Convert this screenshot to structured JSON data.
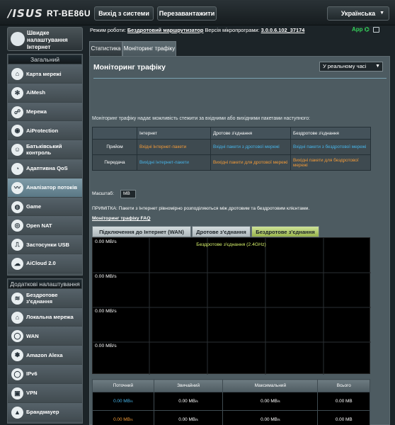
{
  "header": {
    "logo": "/ISUS",
    "model": "RT-BE86U",
    "logout_label": "Вихід з системи",
    "reboot_label": "Перезавантажити",
    "language": "Українська"
  },
  "status_bar": {
    "mode_label": "Режим роботи:",
    "mode_value": "Бездротовий маршрутизатор",
    "firmware_label": "Версія мікропрограми:",
    "firmware_value": "3.0.0.6.102_37174",
    "app_label": "App"
  },
  "sidebar": {
    "qis_label": "Швидке налаштування Інтернет",
    "general_title": "Загальний",
    "general_items": [
      {
        "label": "Карта мережі",
        "icon": "network-map-icon",
        "glyph": "⌂"
      },
      {
        "label": "AiMesh",
        "icon": "aimesh-icon",
        "glyph": "✻"
      },
      {
        "label": "Мережа",
        "icon": "network-icon",
        "glyph": "☍"
      },
      {
        "label": "AiProtection",
        "icon": "aiprotection-icon",
        "glyph": "◉"
      },
      {
        "label": "Батьківський контроль",
        "icon": "parental-control-icon",
        "glyph": "☺"
      },
      {
        "label": "Адаптивна QoS",
        "icon": "qos-icon",
        "glyph": "◔"
      },
      {
        "label": "Аналізатор потоків",
        "icon": "traffic-analyzer-icon",
        "glyph": "〰"
      },
      {
        "label": "Game",
        "icon": "game-icon",
        "glyph": "◍"
      },
      {
        "label": "Open NAT",
        "icon": "open-nat-icon",
        "glyph": "◎"
      },
      {
        "label": "Застосунки USB",
        "icon": "usb-icon",
        "glyph": "⎍"
      },
      {
        "label": "AiCloud 2.0",
        "icon": "aicloud-icon",
        "glyph": "☁"
      }
    ],
    "advanced_title": "Додаткові налаштування",
    "advanced_items": [
      {
        "label": "Бездротове з'єднання",
        "icon": "wireless-icon",
        "glyph": "≋"
      },
      {
        "label": "Локальна мережа",
        "icon": "lan-icon",
        "glyph": "⌂"
      },
      {
        "label": "WAN",
        "icon": "wan-icon",
        "glyph": "◯"
      },
      {
        "label": "Amazon Alexa",
        "icon": "alexa-icon",
        "glyph": "✽"
      },
      {
        "label": "IPv6",
        "icon": "ipv6-icon",
        "glyph": "◯"
      },
      {
        "label": "VPN",
        "icon": "vpn-icon",
        "glyph": "▣"
      },
      {
        "label": "Брандмауер",
        "icon": "firewall-icon",
        "glyph": "▲"
      }
    ]
  },
  "tabs": {
    "statistics": "Статистика",
    "monitor": "Моніторинг трафіку"
  },
  "panel": {
    "title": "Моніторинг трафіку",
    "mode_select": "У реальному часі",
    "description": "Моніторинг трафіку надає можливість стежити за вхідними або вихідними пакетами наступного:",
    "legend": {
      "col_internet": "Інтернет",
      "col_wired": "Дротове з'єднання",
      "col_wireless": "Бездротове з'єднання",
      "row_rx": "Прийом",
      "row_tx": "Передача",
      "rx_internet": "Вхідні Інтернет-пакети",
      "rx_wired": "Вхідні пакети з дротової мережі",
      "rx_wireless": "Вхідні пакети з бездротової мережі",
      "tx_internet": "Вихідні Інтернет-пакети",
      "tx_wired": "Вихідні пакети для дротової мережі",
      "tx_wireless": "Вихідні пакети для бездротової мережі"
    },
    "scale_label": "Масштаб:",
    "scale_value": "MB",
    "note": "ПРИМІТКА: Пакети з Інтернет рівномірно розподіляються між дротовим та бездротовим клієнтами.",
    "faq": "Моніторинг трафіку FAQ"
  },
  "chart_tabs": [
    "Підключення до Інтернет (WAN)",
    "Дротове з'єднання",
    "Бездротове з'єднання"
  ],
  "chart_data": {
    "type": "line",
    "title": "Бездротове з'єднання (2.4GHz)",
    "y_ticks": [
      "0.00 MB/s",
      "0.00 MB/s",
      "0.00 MB/s",
      "0.00 MB/s"
    ],
    "grid": true,
    "series": []
  },
  "stats": {
    "headers": [
      "Поточний",
      "Звичайний",
      "Максимальний",
      "Всього"
    ],
    "rows": [
      {
        "color": "#47b4e8",
        "current": "0.00 MB",
        "current_unit": "/s",
        "avg": "0.00 MB",
        "avg_unit": "/s",
        "max": "0.00 MB",
        "max_unit": "/s",
        "total": "0.00 MB"
      },
      {
        "color": "#f19a39",
        "current": "0.00 MB",
        "current_unit": "/s",
        "avg": "0.00 MB",
        "avg_unit": "/s",
        "max": "0.00 MB",
        "max_unit": "/s",
        "total": "0.00 MB"
      }
    ]
  }
}
